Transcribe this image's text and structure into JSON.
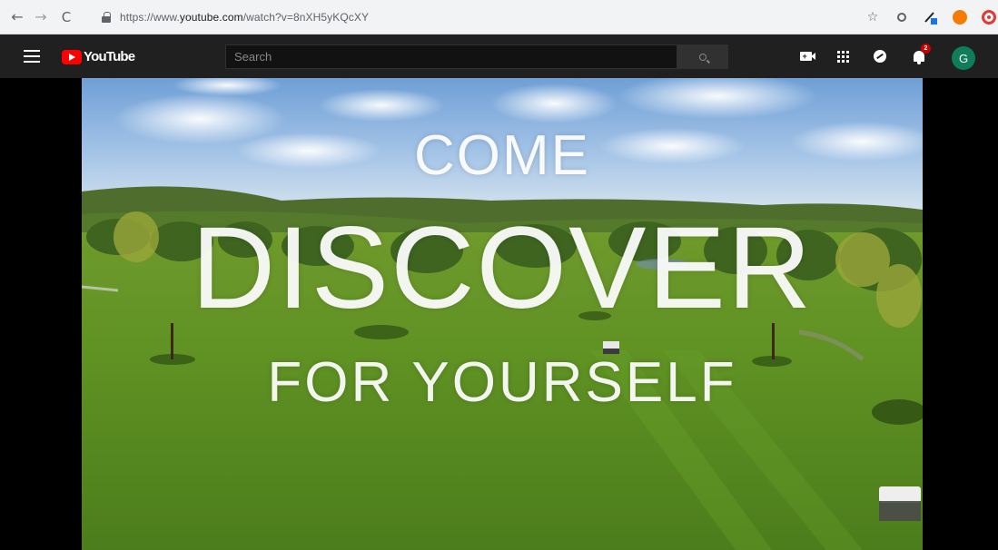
{
  "browser": {
    "url_prefix": "https://www.",
    "url_host": "youtube.com",
    "url_path": "/watch?v=8nXH5yKQcXY",
    "back_icon": "←",
    "forward_icon": "→",
    "reload_icon": "C",
    "star_icon": "☆"
  },
  "masthead": {
    "logo_text": "YouTube",
    "search_placeholder": "Search",
    "notification_count": "2",
    "avatar_letter": "G"
  },
  "video": {
    "line1": "COME",
    "line2": "DISCOVER",
    "line3": "FOR YOURSELF"
  },
  "colors": {
    "youtube_red": "#ff0000",
    "masthead_bg": "#202020",
    "avatar_bg": "#0f7c5a"
  }
}
